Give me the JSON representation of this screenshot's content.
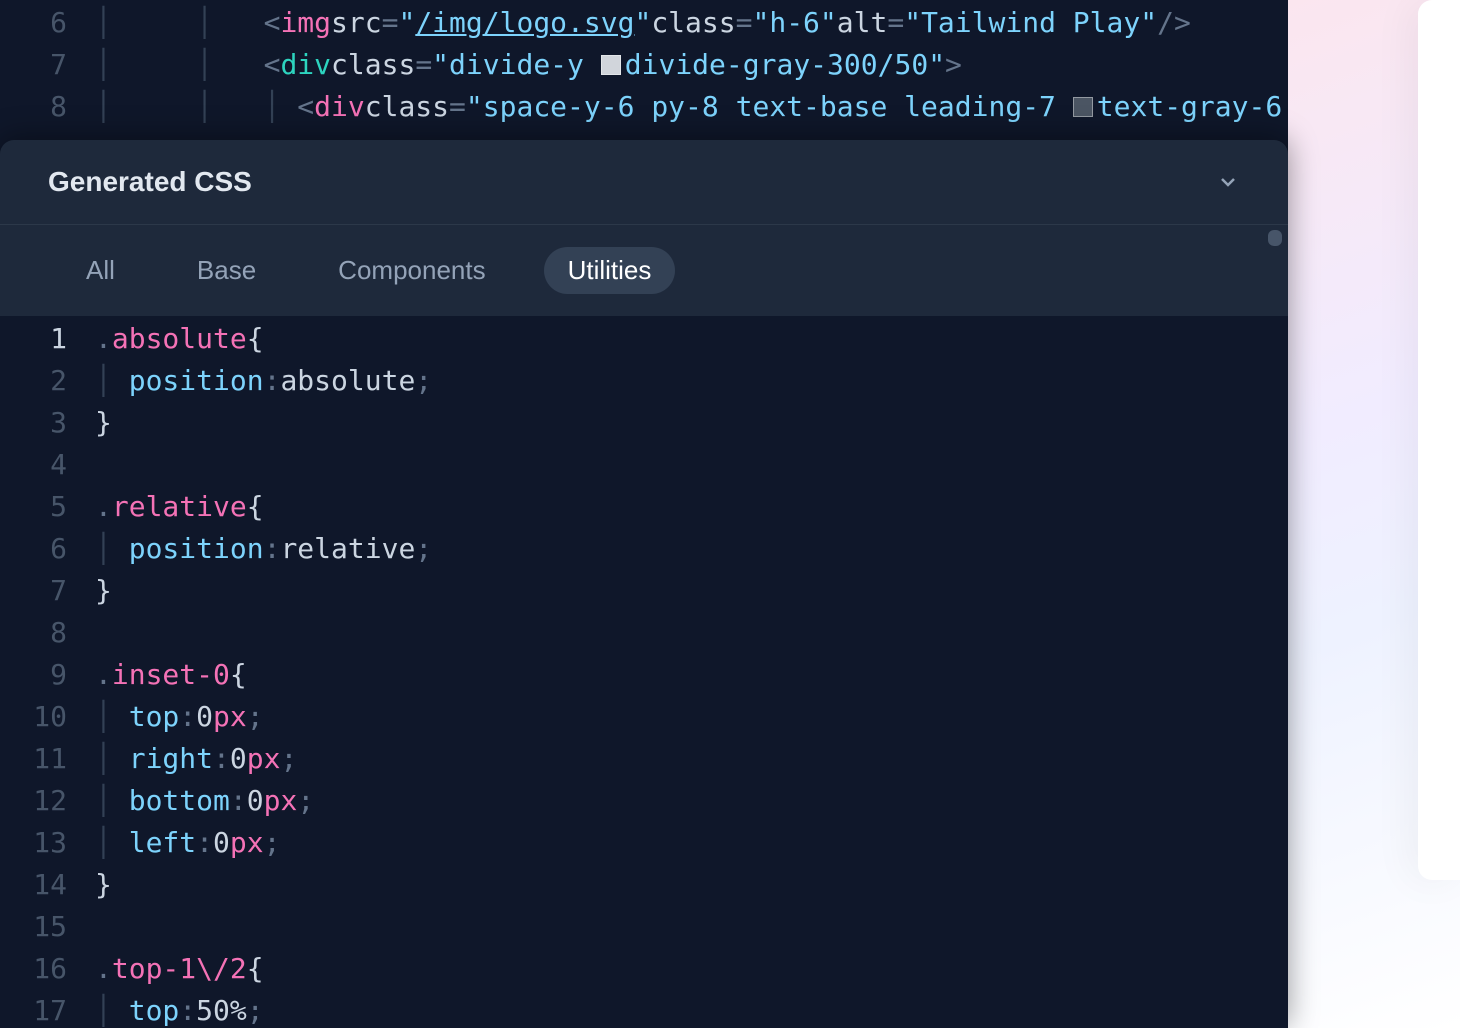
{
  "html_editor": {
    "lines": [
      {
        "num": "6"
      },
      {
        "num": "7"
      },
      {
        "num": "8"
      }
    ],
    "line6": {
      "tag": "img",
      "src_attr": "src",
      "src_val": "/img/logo.svg",
      "class_attr": "class",
      "class_val": "h-6",
      "alt_attr": "alt",
      "alt_val": "Tailwind Play"
    },
    "line7": {
      "tag": "div",
      "class_attr": "class",
      "class_val_a": "divide-y ",
      "class_val_b": "divide-gray-300/50"
    },
    "line8": {
      "tag": "div",
      "class_attr": "class",
      "class_val_a": "space-y-6 py-8 text-base leading-7 ",
      "class_val_b": "text-gray-6"
    }
  },
  "panel": {
    "title": "Generated CSS",
    "tabs": {
      "all": "All",
      "base": "Base",
      "components": "Components",
      "utilities": "Utilities"
    }
  },
  "css": {
    "ln1": "1",
    "ln2": "2",
    "ln3": "3",
    "ln4": "4",
    "ln5": "5",
    "ln6": "6",
    "ln7": "7",
    "ln8": "8",
    "ln9": "9",
    "ln10": "10",
    "ln11": "11",
    "ln12": "12",
    "ln13": "13",
    "ln14": "14",
    "ln15": "15",
    "ln16": "16",
    "ln17": "17",
    "r1": {
      "sel": "absolute",
      "prop": "position",
      "val": "absolute"
    },
    "r2": {
      "sel": "relative",
      "prop": "position",
      "val": "relative"
    },
    "r3": {
      "sel": "inset-0",
      "p1": "top",
      "n1": "0",
      "u1": "px",
      "p2": "right",
      "n2": "0",
      "u2": "px",
      "p3": "bottom",
      "n3": "0",
      "u3": "px",
      "p4": "left",
      "n4": "0",
      "u4": "px"
    },
    "r4": {
      "sel": "top-1\\/2",
      "prop": "top",
      "val": "50%"
    }
  }
}
